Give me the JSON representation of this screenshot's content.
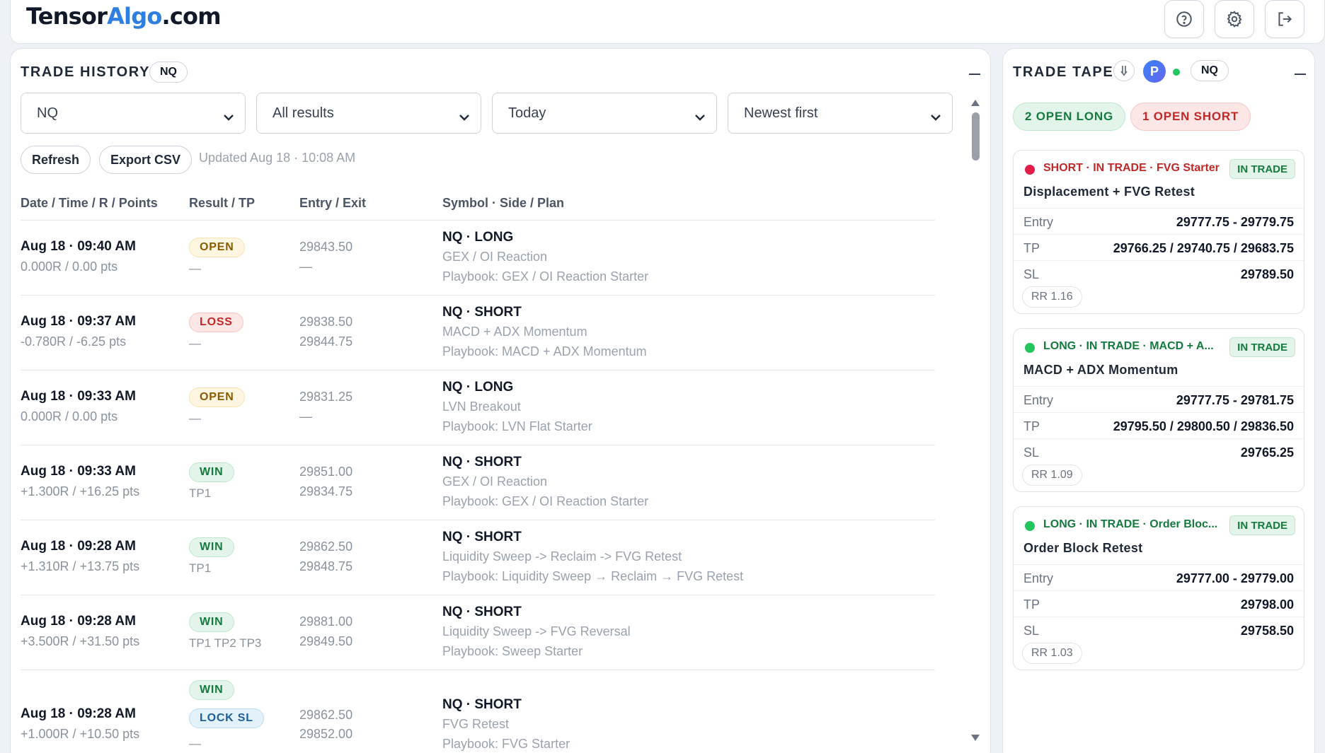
{
  "app": {
    "logo_part1": "Tensor",
    "logo_part2": "Algo",
    "logo_part3": ".com",
    "accent_color": "#2f7fe0",
    "top_icons": [
      "help-icon",
      "gear-icon",
      "logout-icon"
    ]
  },
  "history": {
    "title": "TRADE HISTORY",
    "symbol_badge": "NQ",
    "filters": {
      "symbol": "NQ",
      "result": "All results",
      "range": "Today",
      "sort": "Newest first"
    },
    "refresh_label": "Refresh",
    "export_label": "Export CSV",
    "updated": "Updated Aug 18 · 10:08 AM",
    "columns": [
      "Date / Time / R / Points",
      "Result / TP",
      "Entry / Exit",
      "Symbol · Side / Plan"
    ],
    "rows": [
      {
        "date": "Aug 18 · 09:40 AM",
        "rpts": "0.000R / 0.00 pts",
        "badge": "OPEN",
        "tp": "—",
        "entry": "29843.50",
        "exit": "—",
        "sym": "NQ · LONG",
        "strategy": "GEX / OI Reaction",
        "playbook": "Playbook: GEX / OI Reaction Starter"
      },
      {
        "date": "Aug 18 · 09:37 AM",
        "rpts": "-0.780R / -6.25 pts",
        "badge": "LOSS",
        "tp": "—",
        "entry": "29838.50",
        "exit": "29844.75",
        "sym": "NQ · SHORT",
        "strategy": "MACD + ADX Momentum",
        "playbook": "Playbook: MACD + ADX Momentum"
      },
      {
        "date": "Aug 18 · 09:33 AM",
        "rpts": "0.000R / 0.00 pts",
        "badge": "OPEN",
        "tp": "—",
        "entry": "29831.25",
        "exit": "—",
        "sym": "NQ · LONG",
        "strategy": "LVN Breakout",
        "playbook": "Playbook: LVN Flat Starter"
      },
      {
        "date": "Aug 18 · 09:33 AM",
        "rpts": "+1.300R / +16.25 pts",
        "badge": "WIN",
        "tp": "TP1",
        "entry": "29851.00",
        "exit": "29834.75",
        "sym": "NQ · SHORT",
        "strategy": "GEX / OI Reaction",
        "playbook": "Playbook: GEX / OI Reaction Starter"
      },
      {
        "date": "Aug 18 · 09:28 AM",
        "rpts": "+1.310R / +13.75 pts",
        "badge": "WIN",
        "tp": "TP1",
        "entry": "29862.50",
        "exit": "29848.75",
        "sym": "NQ · SHORT",
        "strategy": "Liquidity Sweep -> Reclaim -> FVG Retest",
        "playbook": "Playbook: Liquidity Sweep → Reclaim → FVG Retest"
      },
      {
        "date": "Aug 18 · 09:28 AM",
        "rpts": "+3.500R / +31.50 pts",
        "badge": "WIN",
        "tp": "TP1 TP2 TP3",
        "entry": "29881.00",
        "exit": "29849.50",
        "sym": "NQ · SHORT",
        "strategy": "Liquidity Sweep -> FVG Reversal",
        "playbook": "Playbook: Sweep Starter"
      },
      {
        "date": "Aug 18 · 09:28 AM",
        "rpts": "+1.000R / +10.50 pts",
        "badge": "WIN",
        "badge2": "LOCK SL",
        "tp": "—",
        "entry": "29862.50",
        "exit": "29852.00",
        "sym": "NQ · SHORT",
        "strategy": "FVG Retest",
        "playbook": "Playbook: FVG Starter"
      }
    ]
  },
  "tape": {
    "title": "TRADE TAPE",
    "p_badge": "P",
    "symbol_badge": "NQ",
    "open_long": "2 OPEN LONG",
    "open_short": "1 OPEN SHORT",
    "cards": [
      {
        "side_color": "#e11d48",
        "header": "SHORT · IN TRADE · FVG Starter",
        "header_color": "#c22828",
        "state": "IN TRADE",
        "name": "Displacement + FVG Retest",
        "entry_label": "Entry",
        "entry": "29777.75 - 29779.75",
        "tp_label": "TP",
        "tp": "29766.25 / 29740.75 / 29683.75",
        "sl_label": "SL",
        "sl": "29789.50",
        "rr": "RR 1.16"
      },
      {
        "side_color": "#22c55e",
        "header": "LONG · IN TRADE · MACD + A...",
        "header_color": "#147a3e",
        "state": "IN TRADE",
        "name": "MACD + ADX Momentum",
        "entry_label": "Entry",
        "entry": "29777.75 - 29781.75",
        "tp_label": "TP",
        "tp": "29795.50 / 29800.50 / 29836.50",
        "sl_label": "SL",
        "sl": "29765.25",
        "rr": "RR 1.09"
      },
      {
        "side_color": "#22c55e",
        "header": "LONG · IN TRADE · Order Bloc...",
        "header_color": "#147a3e",
        "state": "IN TRADE",
        "name": "Order Block Retest",
        "entry_label": "Entry",
        "entry": "29777.00 - 29779.00",
        "tp_label": "TP",
        "tp": "29798.00",
        "sl_label": "SL",
        "sl": "29758.50",
        "rr": "RR 1.03"
      }
    ]
  }
}
